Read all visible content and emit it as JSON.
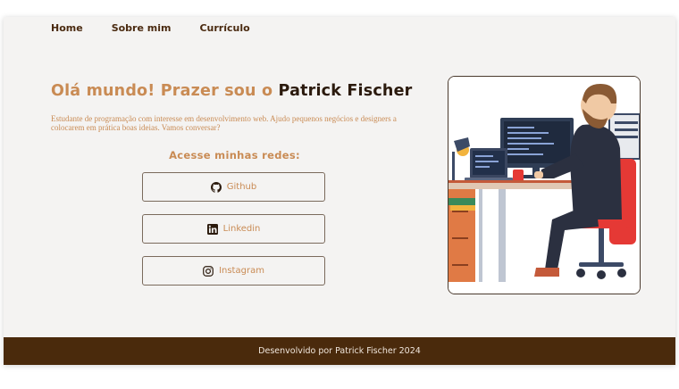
{
  "nav": {
    "items": [
      {
        "label": "Home"
      },
      {
        "label": "Sobre mim"
      },
      {
        "label": "Currículo"
      }
    ]
  },
  "hero": {
    "greeting": "Olá mundo! Prazer sou o",
    "name": "Patrick Fischer",
    "intro": "Estudante de programação com interesse em desenvolvimento web. Ajudo pequenos negócios e designers a colocarem em prática boas ideias. Vamos conversar?"
  },
  "socials": {
    "title": "Acesse minhas redes:",
    "buttons": [
      {
        "label": "Github",
        "icon": "github-icon"
      },
      {
        "label": "Linkedin",
        "icon": "linkedin-icon"
      },
      {
        "label": "Instagram",
        "icon": "instagram-icon"
      }
    ]
  },
  "illustration": {
    "subject": "developer-at-desk-illustration"
  },
  "footer": {
    "text": "Desenvolvido por Patrick Fischer 2024"
  },
  "colors": {
    "accent": "#c98b54",
    "dark_brown": "#2b1a0d",
    "footer_bg": "#4a2a0c",
    "page_bg": "#f4f3f2"
  }
}
